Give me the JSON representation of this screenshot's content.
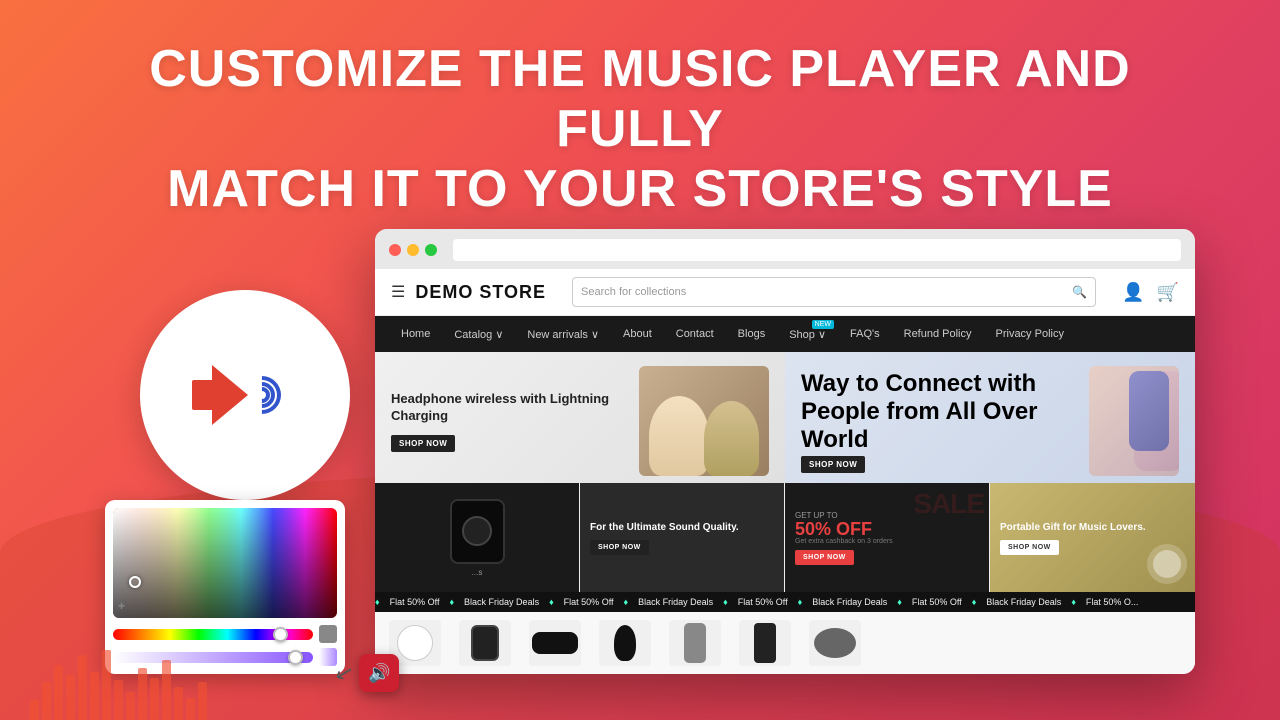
{
  "headline": {
    "line1": "CUSTOMIZE THE MUSIC PLAYER AND FULLY",
    "line2": "MATCH IT TO YOUR STORE'S STYLE"
  },
  "browser": {
    "store_name": "DEMO STORE",
    "search_placeholder": "Search for collections",
    "nav": [
      {
        "label": "Home",
        "has_badge": false
      },
      {
        "label": "Catalog ∨",
        "has_badge": false
      },
      {
        "label": "New arrivals ∨",
        "has_badge": false
      },
      {
        "label": "About",
        "has_badge": false
      },
      {
        "label": "Contact",
        "has_badge": false
      },
      {
        "label": "Blogs",
        "has_badge": false
      },
      {
        "label": "Shop ∨",
        "has_badge": true,
        "badge": "NEW"
      },
      {
        "label": "FAQ's",
        "has_badge": false
      },
      {
        "label": "Refund Policy",
        "has_badge": false
      },
      {
        "label": "Privacy Policy",
        "has_badge": false
      }
    ],
    "hero_left": {
      "title": "Headphone wireless with Lightning Charging",
      "cta": "SHOP NOW"
    },
    "hero_right": {
      "title": "Way to Connect with People from All Over World",
      "cta": "SHOP NOW"
    },
    "products": [
      {
        "type": "speaker",
        "label": ""
      },
      {
        "type": "ultimate",
        "title": "For the Ultimate Sound Quality.",
        "cta": "SHOP NOW"
      },
      {
        "type": "sale",
        "top": "GET UP TO",
        "percent": "50% OFF",
        "sub": "Get extra cashback on 3 orders",
        "cta": "SHOP NOW"
      },
      {
        "type": "portable",
        "title": "Portable Gift for Music Lovers.",
        "cta": "SHOP NOW"
      }
    ],
    "ticker_items": [
      "♦ Flat 50% Off",
      "♦ Black Friday Deals",
      "♦ Flat 50% Off",
      "♦ Black Friday Deals",
      "♦ Flat 50% Off",
      "♦ Black Friday Deals",
      "♦ Flat 50% Off",
      "♦ Black Friday Deals",
      "♦ Flat 50% Off",
      "♦ Black Friday Deals"
    ]
  },
  "equalizer_heights": [
    20,
    35,
    55,
    45,
    65,
    50,
    70,
    40,
    30,
    55,
    45,
    60,
    35,
    25,
    40,
    50,
    65,
    55,
    35,
    20
  ],
  "mini_player": {
    "icon": "🔊"
  }
}
